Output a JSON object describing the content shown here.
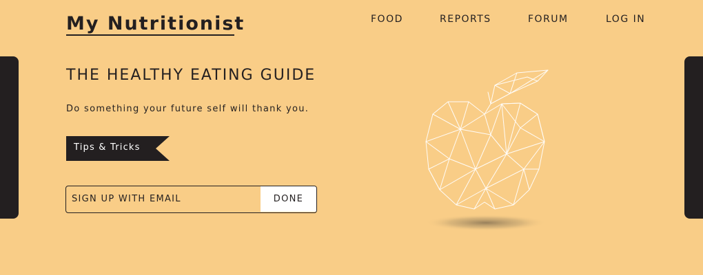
{
  "header": {
    "logo": "My Nutritionist",
    "nav": [
      "FOOD",
      "REPORTS",
      "FORUM",
      "LOG IN"
    ]
  },
  "hero": {
    "title": "THE HEALTHY EATING GUIDE",
    "subtitle": "Do something your future self will thank you.",
    "ribbon_label": "Tips & Tricks"
  },
  "signup": {
    "placeholder": "SIGN UP WITH EMAIL",
    "button_label": "DONE"
  },
  "illustration": {
    "icon": "polygon-apple-icon"
  },
  "colors": {
    "background": "#f9cd87",
    "dark": "#231f20",
    "white": "#ffffff"
  }
}
